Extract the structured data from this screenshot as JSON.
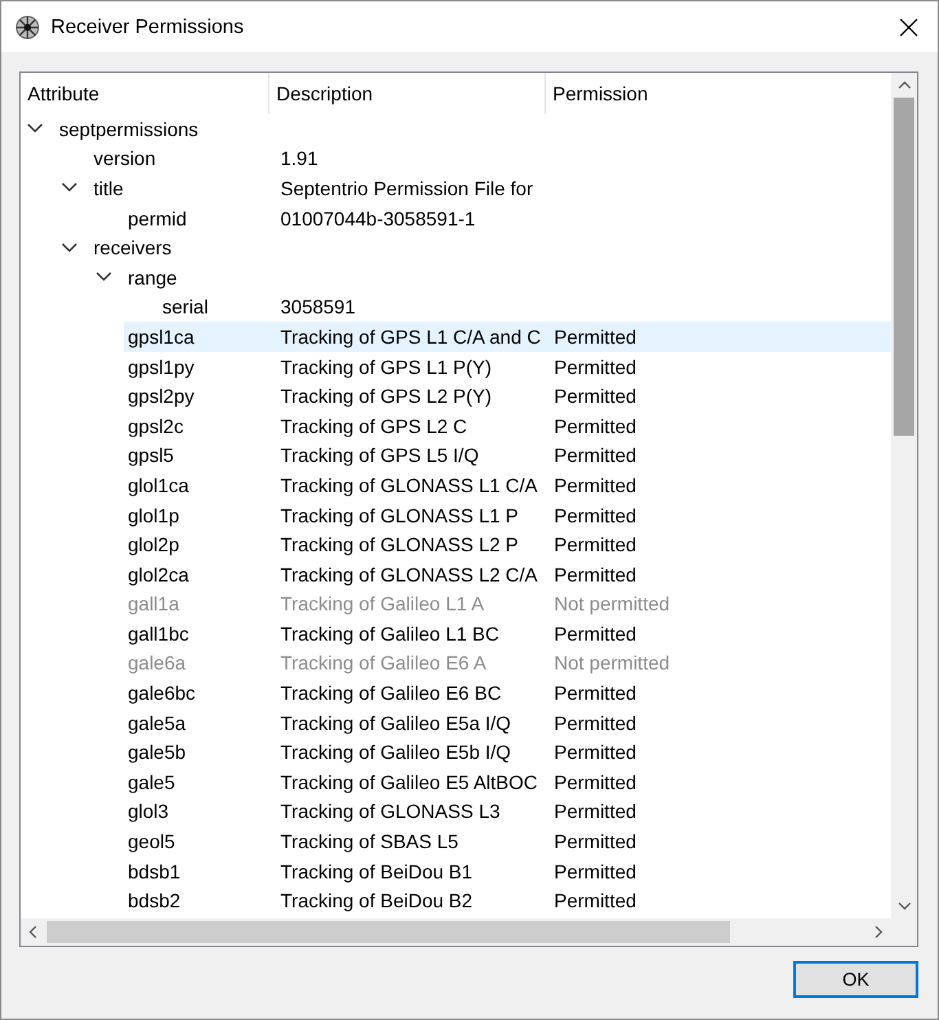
{
  "window": {
    "title": "Receiver Permissions"
  },
  "table": {
    "columns": [
      "Attribute",
      "Description",
      "Permission"
    ],
    "rows": [
      {
        "attribute": "septpermissions",
        "expanded": true,
        "selected": false,
        "children": [
          {
            "attribute": "version",
            "description": "1.91",
            "selected": false
          },
          {
            "attribute": "title",
            "description": "Septentrio Permission File for",
            "expanded": true,
            "selected": false,
            "children": [
              {
                "attribute": "permid",
                "description": "01007044b-3058591-1",
                "selected": false
              }
            ]
          },
          {
            "attribute": "receivers",
            "expanded": true,
            "selected": false,
            "children": [
              {
                "attribute": "range",
                "expanded": true,
                "selected": false,
                "disabled": false,
                "children": [
                  {
                    "attribute": "serial",
                    "description": "3058591",
                    "selected": false
                  }
                ]
              },
              {
                "attribute": "gpsl1ca",
                "description": "Tracking of GPS L1 C/A and C",
                "permission": "Permitted",
                "selected": true,
                "disabled": false
              },
              {
                "attribute": "gpsl1py",
                "description": "Tracking of GPS L1 P(Y)",
                "permission": "Permitted",
                "selected": false,
                "disabled": false
              },
              {
                "attribute": "gpsl2py",
                "description": "Tracking of GPS L2 P(Y)",
                "permission": "Permitted",
                "selected": false,
                "disabled": false
              },
              {
                "attribute": "gpsl2c",
                "description": "Tracking of GPS L2 C",
                "permission": "Permitted",
                "selected": false,
                "disabled": false
              },
              {
                "attribute": "gpsl5",
                "description": "Tracking of GPS L5 I/Q",
                "permission": "Permitted",
                "selected": false,
                "disabled": false
              },
              {
                "attribute": "glol1ca",
                "description": "Tracking of GLONASS L1 C/A",
                "permission": "Permitted",
                "selected": false,
                "disabled": false
              },
              {
                "attribute": "glol1p",
                "description": "Tracking of GLONASS L1 P",
                "permission": "Permitted",
                "selected": false,
                "disabled": false
              },
              {
                "attribute": "glol2p",
                "description": "Tracking of GLONASS L2 P",
                "permission": "Permitted",
                "selected": false,
                "disabled": false
              },
              {
                "attribute": "glol2ca",
                "description": "Tracking of GLONASS L2 C/A",
                "permission": "Permitted",
                "selected": false,
                "disabled": false
              },
              {
                "attribute": "gall1a",
                "description": "Tracking of Galileo L1 A",
                "permission": "Not permitted",
                "selected": false,
                "disabled": true
              },
              {
                "attribute": "gall1bc",
                "description": "Tracking of Galileo L1 BC",
                "permission": "Permitted",
                "selected": false,
                "disabled": false
              },
              {
                "attribute": "gale6a",
                "description": "Tracking of Galileo E6 A",
                "permission": "Not permitted",
                "selected": false,
                "disabled": true
              },
              {
                "attribute": "gale6bc",
                "description": "Tracking of Galileo E6 BC",
                "permission": "Permitted",
                "selected": false,
                "disabled": false
              },
              {
                "attribute": "gale5a",
                "description": "Tracking of Galileo E5a I/Q",
                "permission": "Permitted",
                "selected": false,
                "disabled": false
              },
              {
                "attribute": "gale5b",
                "description": "Tracking of Galileo E5b I/Q",
                "permission": "Permitted",
                "selected": false,
                "disabled": false
              },
              {
                "attribute": "gale5",
                "description": "Tracking of Galileo E5 AltBOC",
                "permission": "Permitted",
                "selected": false,
                "disabled": false
              },
              {
                "attribute": "glol3",
                "description": "Tracking of GLONASS L3",
                "permission": "Permitted",
                "selected": false,
                "disabled": false
              },
              {
                "attribute": "geol5",
                "description": "Tracking of SBAS L5",
                "permission": "Permitted",
                "selected": false,
                "disabled": false
              },
              {
                "attribute": "bdsb1",
                "description": "Tracking of BeiDou B1",
                "permission": "Permitted",
                "selected": false,
                "disabled": false
              },
              {
                "attribute": "bdsb2",
                "description": "Tracking of BeiDou B2",
                "permission": "Permitted",
                "selected": false,
                "disabled": false
              }
            ]
          }
        ]
      }
    ]
  },
  "buttons": [
    "OK"
  ]
}
